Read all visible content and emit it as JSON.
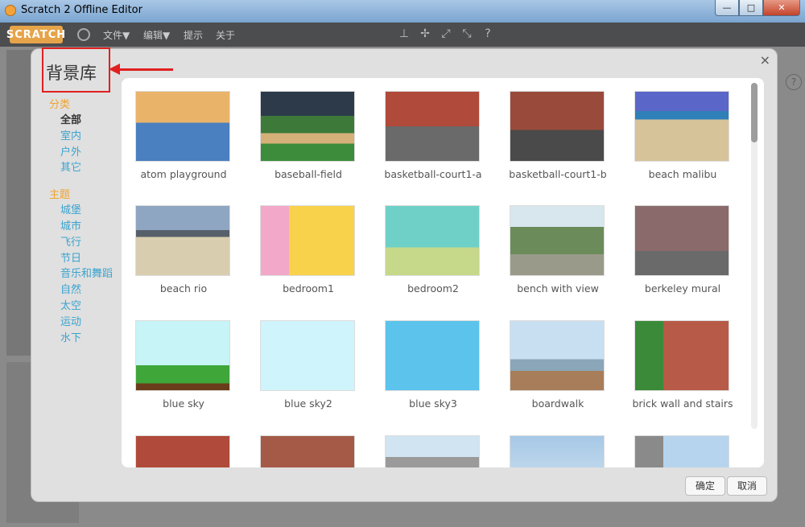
{
  "window": {
    "title": "Scratch 2 Offline Editor"
  },
  "window_controls": {
    "minimize": "—",
    "maximize": "□",
    "close": "✕"
  },
  "menubar": {
    "logo": "SCRATCH",
    "items": [
      "文件▼",
      "编辑▼",
      "提示",
      "关于"
    ]
  },
  "dialog": {
    "title": "背景库",
    "close": "×",
    "categories_heading": "分类",
    "categories": [
      "全部",
      "室内",
      "户外",
      "其它"
    ],
    "themes_heading": "主题",
    "themes": [
      "城堡",
      "城市",
      "飞行",
      "节日",
      "音乐和舞蹈",
      "自然",
      "太空",
      "运动",
      "水下"
    ],
    "ok": "确定",
    "cancel": "取消"
  },
  "backdrops": [
    "atom playground",
    "baseball-field",
    "basketball-court1-a",
    "basketball-court1-b",
    "beach malibu",
    "beach rio",
    "bedroom1",
    "bedroom2",
    "bench with view",
    "berkeley mural",
    "blue sky",
    "blue sky2",
    "blue sky3",
    "boardwalk",
    "brick wall and stairs"
  ],
  "help": "?"
}
